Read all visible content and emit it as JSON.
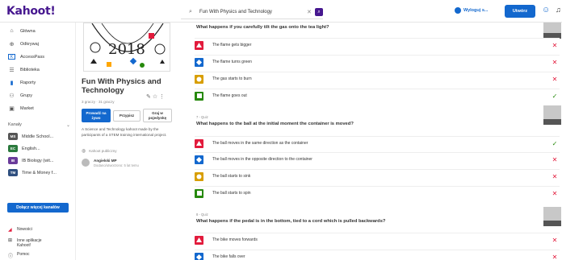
{
  "header": {
    "logo": "Kahoot!",
    "search_value": "Fun With Physics and Technology",
    "hosted_label": "Wyloguj s...",
    "create_label": "Utwórz"
  },
  "sidebar": {
    "items": [
      {
        "label": "Główna",
        "icon": "home-icon"
      },
      {
        "label": "Odkrywaj",
        "icon": "compass-icon"
      },
      {
        "label": "AccessPass",
        "icon": "accesspass-icon"
      },
      {
        "label": "Biblioteka",
        "icon": "library-icon"
      },
      {
        "label": "Raporty",
        "icon": "reports-icon"
      },
      {
        "label": "Grupy",
        "icon": "groups-icon"
      },
      {
        "label": "Market",
        "icon": "market-icon"
      }
    ],
    "channels_label": "Kanały",
    "channels": [
      {
        "badge": "MS",
        "label": "Middle School...",
        "color": "#555555"
      },
      {
        "badge": "EC",
        "label": "English...",
        "color": "#2b7a3d"
      },
      {
        "badge": "IB",
        "label": "IB Biology (wit...",
        "color": "#6a3b9a"
      },
      {
        "badge": "TM",
        "label": "Time & Money f...",
        "color": "#2f4f7f"
      }
    ],
    "join_more_label": "Dołącz więcej kanałów",
    "footer": [
      {
        "label": "Nowości",
        "icon": "megaphone-icon"
      },
      {
        "label": "Inne aplikacje Kahoot!",
        "icon": "apps-icon"
      },
      {
        "label": "Pomoc",
        "icon": "help-icon"
      }
    ]
  },
  "detail": {
    "cover_text": "2018",
    "title": "Fun With Physics and Technology",
    "meta": "3 graczy · 31 graczy",
    "play_label": "Prowadź na żywo",
    "assign_label": "Przypisz",
    "solo_label": "Graj w pojedynkę",
    "description": "A Science and Technology kahoot made by the participants of a STEM training international project.",
    "favorite_label": "Kahoot publiczny",
    "author_name": "Angielski MP",
    "author_sub": "Dodano/utworzono: 5 lat temu"
  },
  "questions": [
    {
      "label": "",
      "text": "What happens if you carefully tilt the gas onto the tea light?",
      "answers": [
        {
          "text": "The flame gets bigger",
          "correct": false
        },
        {
          "text": "The flame turns green",
          "correct": false
        },
        {
          "text": "The gas starts to burn",
          "correct": false
        },
        {
          "text": "The flame goes out",
          "correct": true
        }
      ]
    },
    {
      "label": "7 - Quiz",
      "text": "What happens to the ball at the initial moment the container is moved?",
      "answers": [
        {
          "text": "The ball moves in the same direction as the container",
          "correct": true
        },
        {
          "text": "The ball moves in the opposite direction to the container",
          "correct": false
        },
        {
          "text": "The ball starts to sink",
          "correct": false
        },
        {
          "text": "The ball starts to spin",
          "correct": false
        }
      ]
    },
    {
      "label": "8 - Quiz",
      "text": "What happens if the pedal is in the bottom, tied to a cord which is pulled backwards?",
      "answers": [
        {
          "text": "The bike moves forwards",
          "correct": false
        },
        {
          "text": "The bike falls over",
          "correct": false
        }
      ]
    }
  ],
  "colors": {
    "red": "#e21b3c",
    "blue": "#1368ce",
    "yellow": "#d89e00",
    "green": "#26890c"
  }
}
